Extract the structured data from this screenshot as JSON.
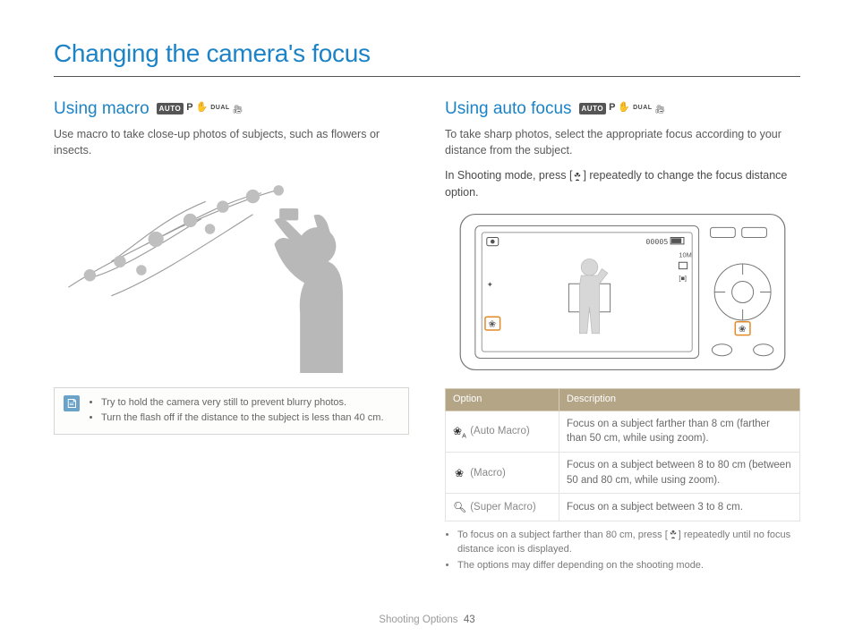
{
  "page": {
    "title": "Changing the camera's focus",
    "footer_section": "Shooting Options",
    "footer_page": "43"
  },
  "modes": {
    "auto": "AUTO",
    "p": "P",
    "dual": "DUAL"
  },
  "left": {
    "heading": "Using macro",
    "lead": "Use macro to take close-up photos of subjects, such as flowers or insects.",
    "tips": [
      "Try to hold the camera very still to prevent blurry photos.",
      "Turn the flash off if the distance to the subject is less than 40 cm."
    ]
  },
  "right": {
    "heading": "Using auto focus",
    "lead": "To take sharp photos, select the appropriate focus according to your distance from the subject.",
    "instruction_pre": "In Shooting mode, press [",
    "instruction_post": "] repeatedly to change the focus distance option.",
    "screen": {
      "counter": "00005",
      "res": "10M"
    },
    "table": {
      "headers": {
        "option": "Option",
        "description": "Description"
      },
      "rows": [
        {
          "icon": "auto-macro",
          "label": "(Auto Macro)",
          "desc": "Focus on a subject farther than 8 cm (farther than 50 cm, while using zoom)."
        },
        {
          "icon": "macro",
          "label": "(Macro)",
          "desc": "Focus on a subject between 8 to 80 cm (between 50 and 80 cm, while using zoom)."
        },
        {
          "icon": "super-macro",
          "label": "(Super Macro)",
          "desc": "Focus on a subject between 3 to 8 cm."
        }
      ]
    },
    "footnotes_pre": "To focus on a subject farther than 80 cm, press [",
    "footnotes_post": "] repeatedly until no focus distance icon is displayed.",
    "footnote2": "The options may differ depending on the shooting mode."
  }
}
